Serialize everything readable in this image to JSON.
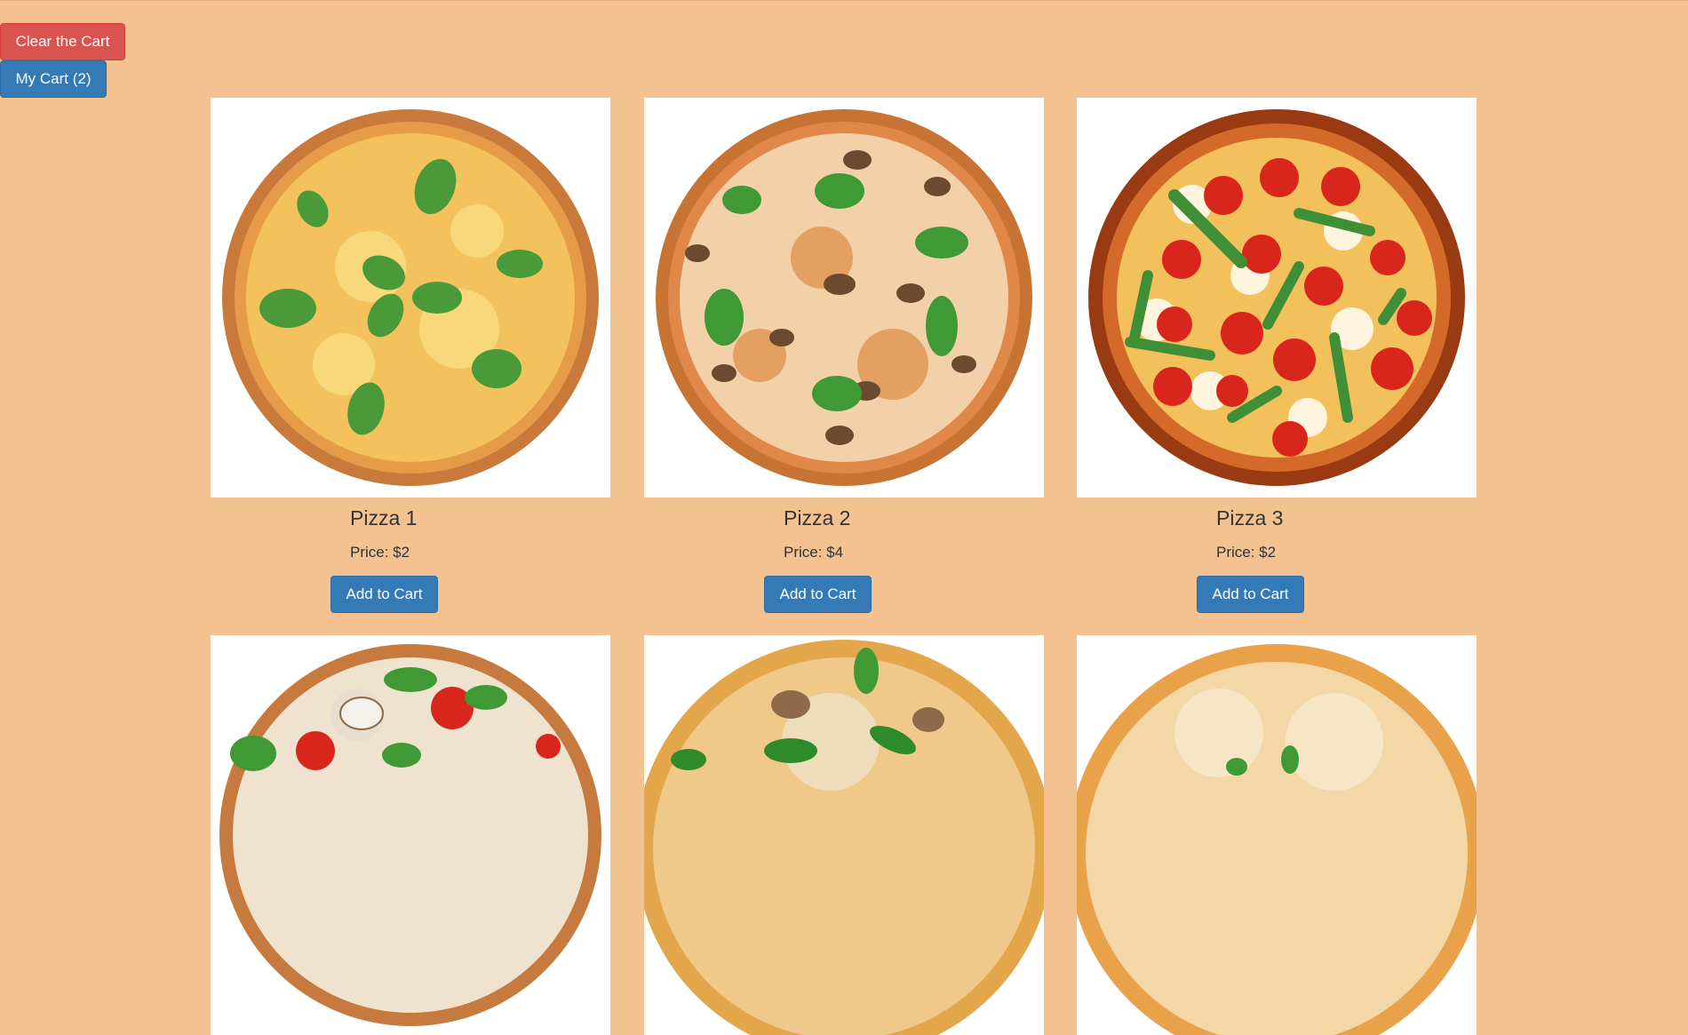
{
  "toolbar": {
    "clear_label": "Clear the Cart",
    "cart_label": "My Cart (2)"
  },
  "products": [
    {
      "name": "Pizza 1",
      "price": "Price: $2",
      "button": "Add to Cart",
      "image": "pizza-margherita-cheese-basil"
    },
    {
      "name": "Pizza 2",
      "price": "Price: $4",
      "button": "Add to Cart",
      "image": "pizza-mushroom-basil"
    },
    {
      "name": "Pizza 3",
      "price": "Price: $2",
      "button": "Add to Cart",
      "image": "pizza-tomato-mozzarella-arugula"
    },
    {
      "name": "",
      "price": "",
      "button": "",
      "image": "pizza-tomato-mushroom-basil"
    },
    {
      "name": "",
      "price": "",
      "button": "",
      "image": "pizza-mushroom-basil-pepper"
    },
    {
      "name": "",
      "price": "",
      "button": "",
      "image": "pizza-cheese-basil"
    }
  ],
  "colors": {
    "background": "#f4c291",
    "danger": "#d9534f",
    "primary": "#337ab7"
  }
}
